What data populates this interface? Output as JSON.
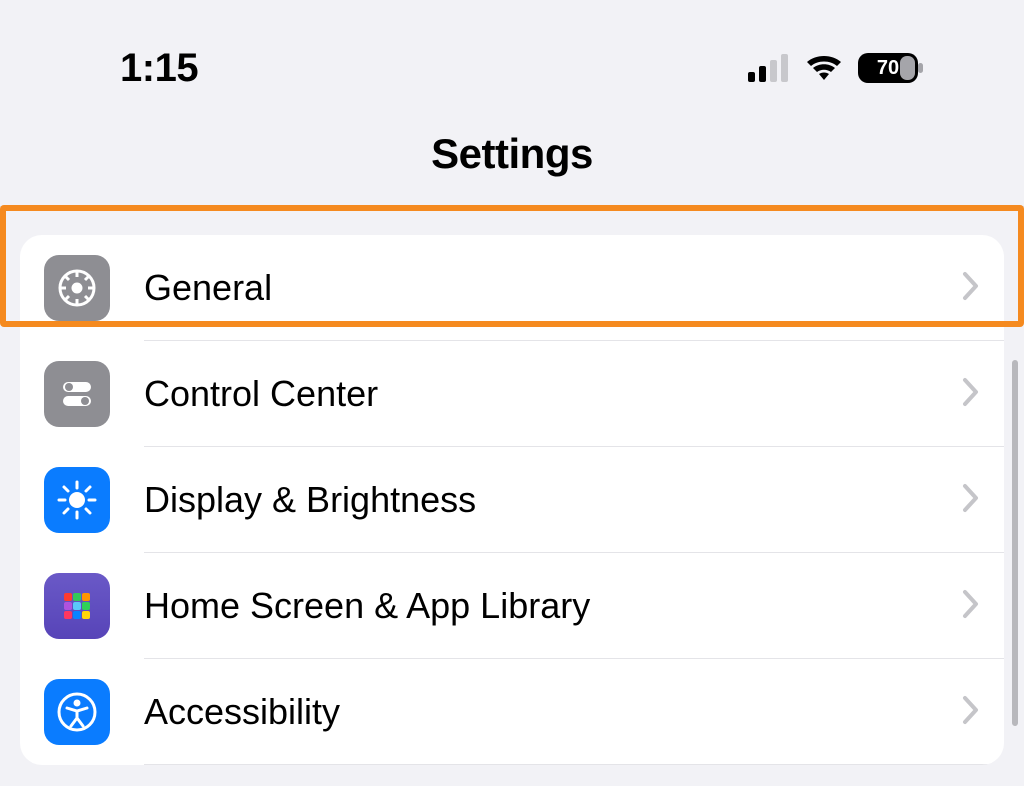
{
  "status": {
    "time": "1:15",
    "battery": "70"
  },
  "title": "Settings",
  "rows": [
    {
      "icon": "gear-icon",
      "label": "General"
    },
    {
      "icon": "toggles-icon",
      "label": "Control Center"
    },
    {
      "icon": "brightness-icon",
      "label": "Display & Brightness"
    },
    {
      "icon": "app-grid-icon",
      "label": "Home Screen & App Library"
    },
    {
      "icon": "accessibility-icon",
      "label": "Accessibility"
    }
  ],
  "highlight_row": 0
}
